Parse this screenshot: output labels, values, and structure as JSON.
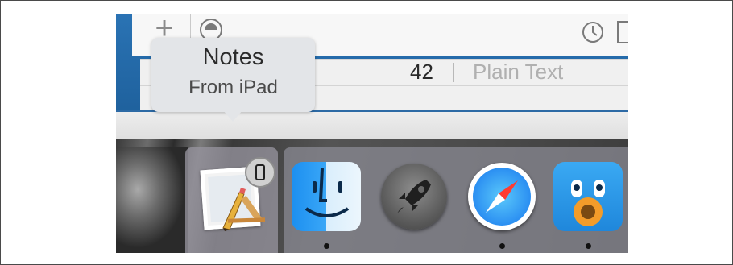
{
  "window": {
    "toolbar": {
      "add_symbol": "+",
      "icons": [
        "plus-icon",
        "circle-minus-icon",
        "clock-icon",
        "close-box-icon"
      ]
    },
    "status_row": {
      "count": "42",
      "mode": "Plain Text"
    }
  },
  "tooltip": {
    "title": "Notes",
    "subtitle": "From iPad"
  },
  "dock": {
    "handoff": {
      "icon": "handoff-notes-icon",
      "badge_icon": "ipad-badge-icon"
    },
    "items": [
      {
        "icon": "finder-icon",
        "running": true
      },
      {
        "icon": "launchpad-icon",
        "running": false
      },
      {
        "icon": "safari-icon",
        "running": true
      },
      {
        "icon": "tweetbot-icon",
        "running": true
      }
    ]
  },
  "colors": {
    "window_blue": "#1f5f97",
    "tooltip_bg": "#e3e5e8",
    "finder_blue": "#1c8ff0",
    "safari_blue": "#2b8ff2",
    "tweetbot_blue": "#3aa9f3"
  }
}
